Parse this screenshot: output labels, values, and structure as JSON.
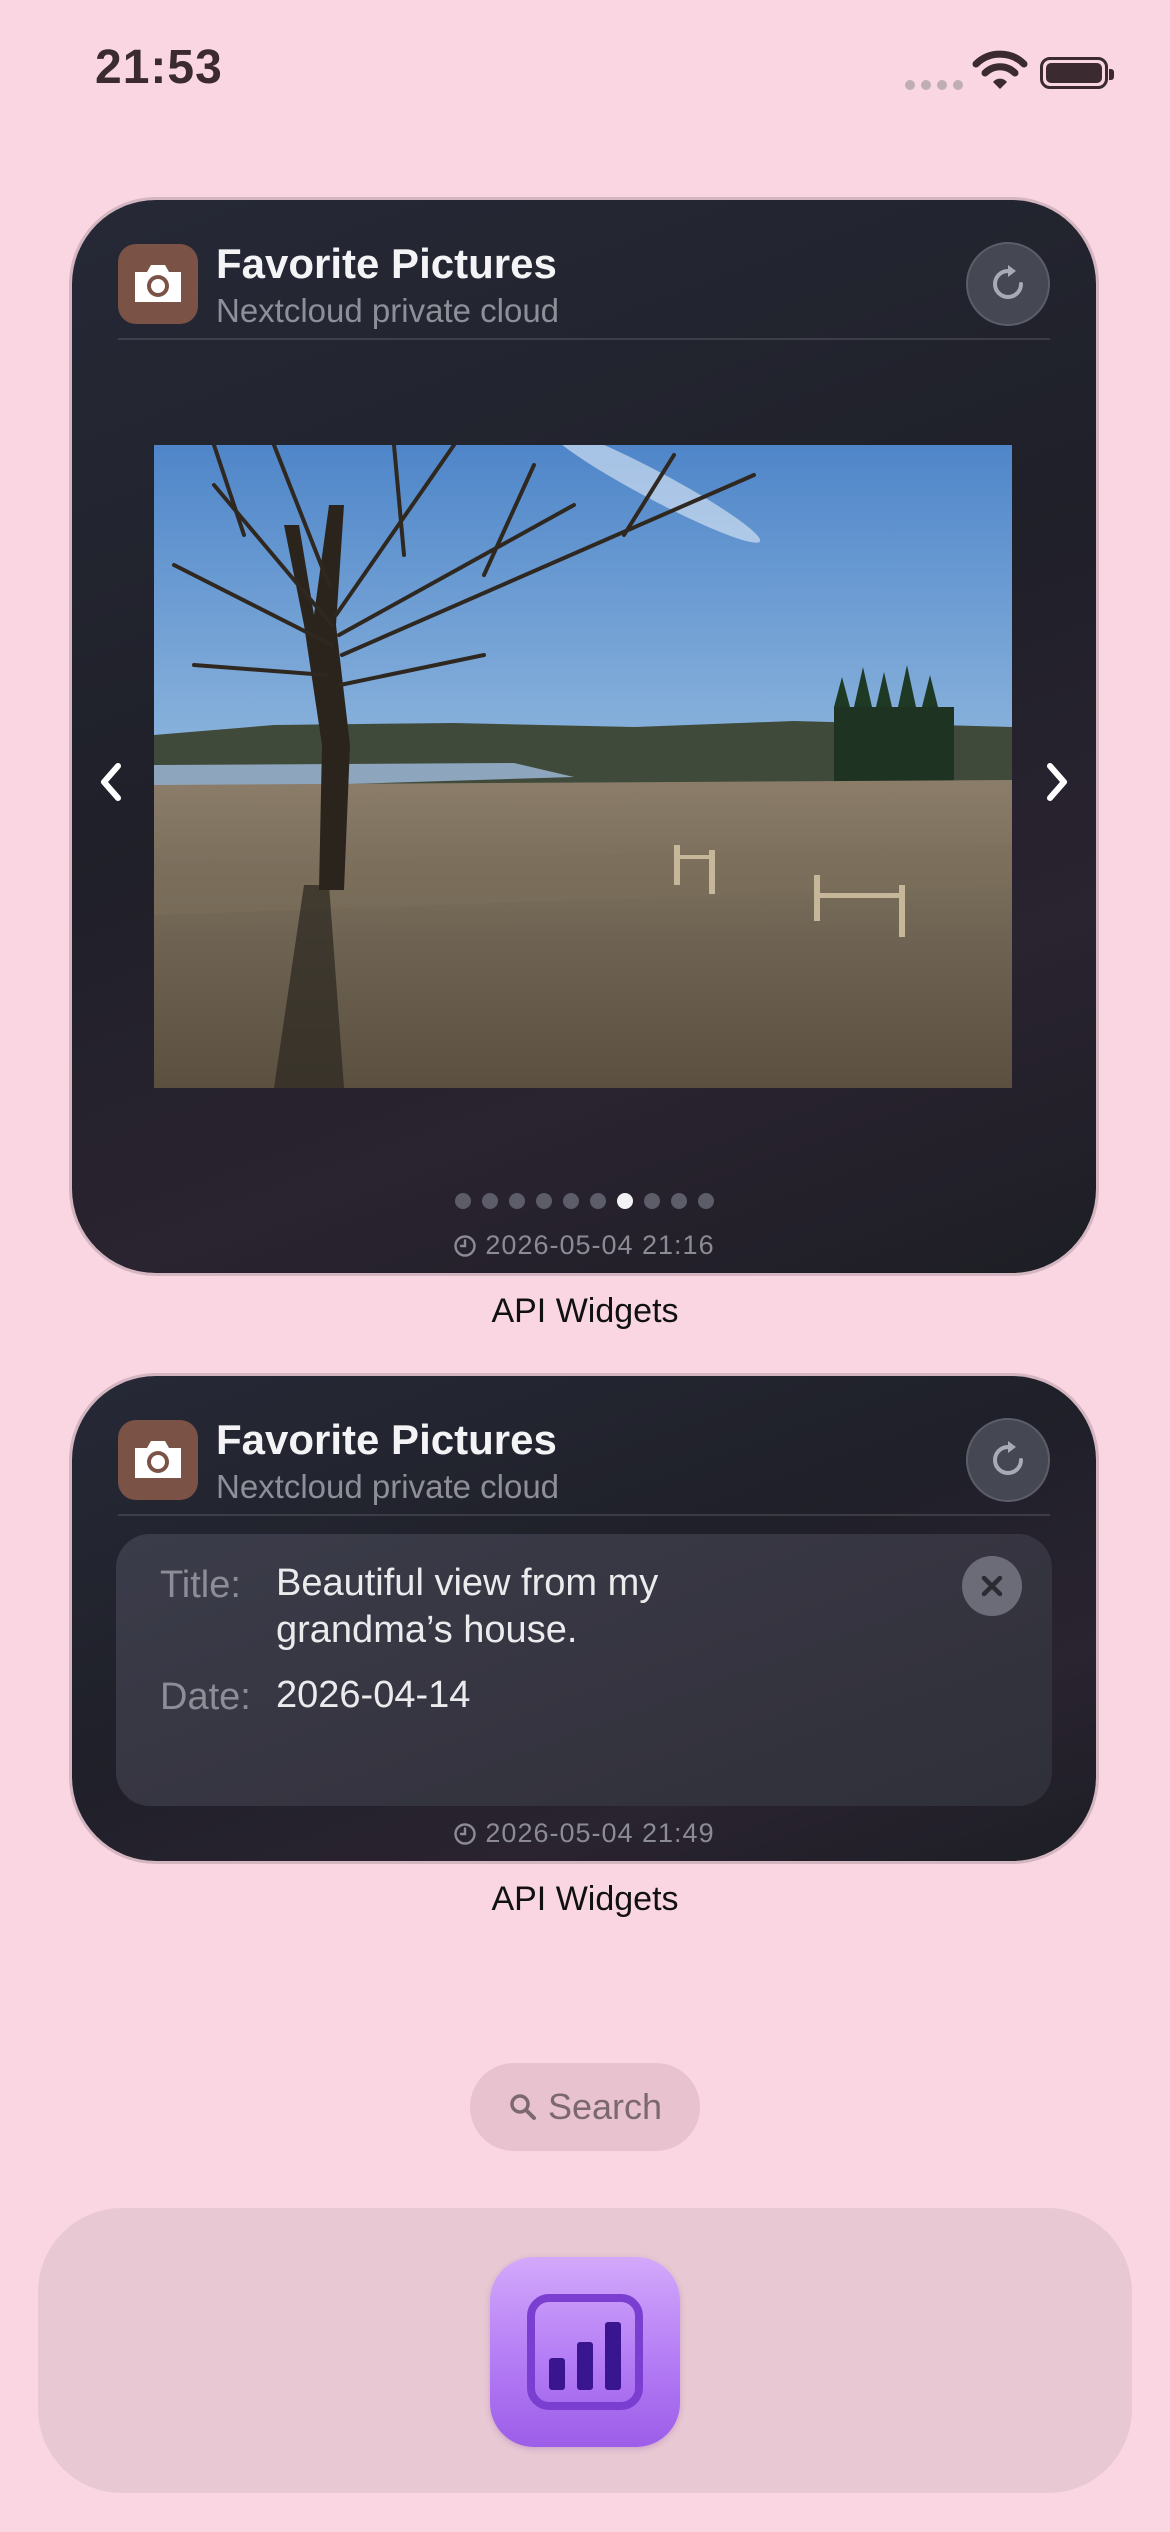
{
  "status_bar": {
    "time": "21:53"
  },
  "widgets": [
    {
      "title": "Favorite Pictures",
      "subtitle": "Nextcloud private cloud",
      "page_count": 10,
      "active_page_index": 6,
      "timestamp": "2026-05-04 21:16",
      "caption": "API Widgets",
      "photo_description_icon": "photo"
    },
    {
      "title": "Favorite Pictures",
      "subtitle": "Nextcloud private cloud",
      "details": {
        "title_label": "Title:",
        "title_value_line1": "Beautiful view from my",
        "title_value_line2": "grandma’s house.",
        "date_label": "Date:",
        "date_value": "2026-04-14"
      },
      "timestamp": "2026-05-04 21:49",
      "caption": "API Widgets"
    }
  ],
  "search": {
    "label": "Search"
  },
  "dock": {
    "apps": [
      {
        "icon": "bar-chart-icon",
        "accent": "#b47cf5"
      }
    ]
  },
  "colors": {
    "background": "#f9d6e2",
    "widget_bg": "#22232c",
    "app_icon": "#7a5346"
  }
}
